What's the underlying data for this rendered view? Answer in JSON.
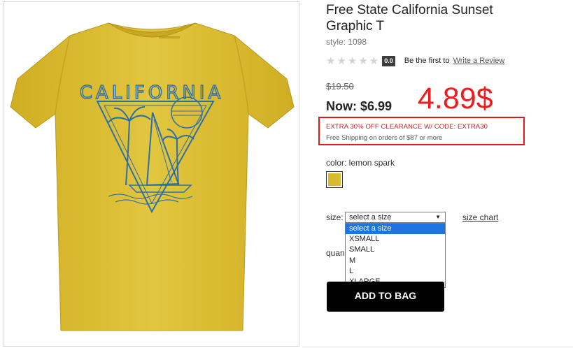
{
  "product": {
    "title": "Free State California Sunset Graphic T",
    "style_line": "style: 1098",
    "rating": {
      "stars": "★★★★★",
      "score": "0.0",
      "be_first": "Be the first to",
      "review_link": "Write a Review"
    },
    "price": {
      "was": "$19.50",
      "now": "Now: $6.99"
    },
    "annotation_price": "4.89$",
    "promo": {
      "code_text": "EXTRA 30% OFF CLEARANCE W/ CODE: EXTRA30",
      "shipping_text": "Free Shipping on orders of $87 or more"
    },
    "color": {
      "label": "color: lemon spark",
      "swatch_color": "#d8ba2e"
    },
    "size": {
      "label": "size:",
      "selected": "select a size",
      "options": [
        "select a size",
        "XSMALL",
        "SMALL",
        "M",
        "L",
        "XLARGE"
      ],
      "chart_link": "size chart"
    },
    "quantity_label": "quan",
    "add_to_bag": "ADD TO BAG",
    "image": {
      "shirt_text": "CALIFORNIA",
      "shirt_color": "#dcbf36",
      "print_color": "#2f6fa8"
    }
  }
}
